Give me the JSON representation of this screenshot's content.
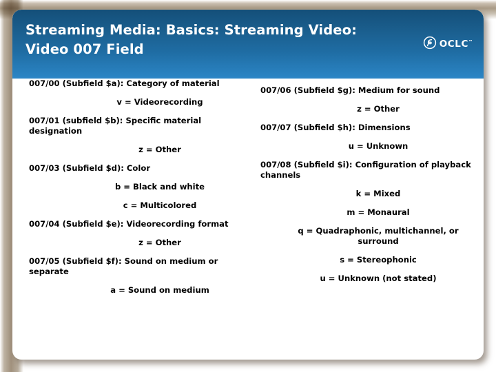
{
  "header": {
    "title": "Streaming Media:  Basics:  Streaming Video:\nVideo 007 Field",
    "logo": {
      "wordmark": "OCLC",
      "trademark": "™"
    },
    "colors": {
      "gradient_top": "#144f79",
      "gradient_bottom": "#2c86c6",
      "text": "#ffffff"
    }
  },
  "content": {
    "left_column": [
      {
        "kind": "field",
        "text": "007/00 (Subfield $a):  Category of material"
      },
      {
        "kind": "value",
        "text": "v = Videorecording"
      },
      {
        "kind": "field",
        "text": "007/01 (subfield $b):  Specific material designation"
      },
      {
        "kind": "value",
        "text": "z = Other"
      },
      {
        "kind": "field",
        "text": "007/03 (Subfield $d):  Color"
      },
      {
        "kind": "value",
        "text": "b = Black and white"
      },
      {
        "kind": "value",
        "text": "c = Multicolored"
      },
      {
        "kind": "field",
        "text": "007/04 (Subfield $e):  Videorecording format"
      },
      {
        "kind": "value",
        "text": "z = Other"
      },
      {
        "kind": "field",
        "text": "007/05 (Subfield $f):  Sound on medium or separate"
      },
      {
        "kind": "value",
        "text": "a = Sound on medium"
      }
    ],
    "right_column": [
      {
        "kind": "field",
        "text": "007/06 (Subfield $g):  Medium for sound"
      },
      {
        "kind": "value",
        "text": "z = Other"
      },
      {
        "kind": "field",
        "text": "007/07 (Subfield $h):  Dimensions"
      },
      {
        "kind": "value",
        "text": "u = Unknown"
      },
      {
        "kind": "field",
        "text": "007/08 (Subfield $i):  Configuration of playback channels"
      },
      {
        "kind": "value",
        "text": "k = Mixed"
      },
      {
        "kind": "value",
        "text": "m = Monaural"
      },
      {
        "kind": "value",
        "text": "q = Quadraphonic, multichannel, or surround"
      },
      {
        "kind": "value",
        "text": "s = Stereophonic"
      },
      {
        "kind": "value",
        "text": "u = Unknown (not stated)"
      }
    ]
  },
  "card": {
    "background": "#ffffff",
    "backdrop": "#a99a86"
  }
}
